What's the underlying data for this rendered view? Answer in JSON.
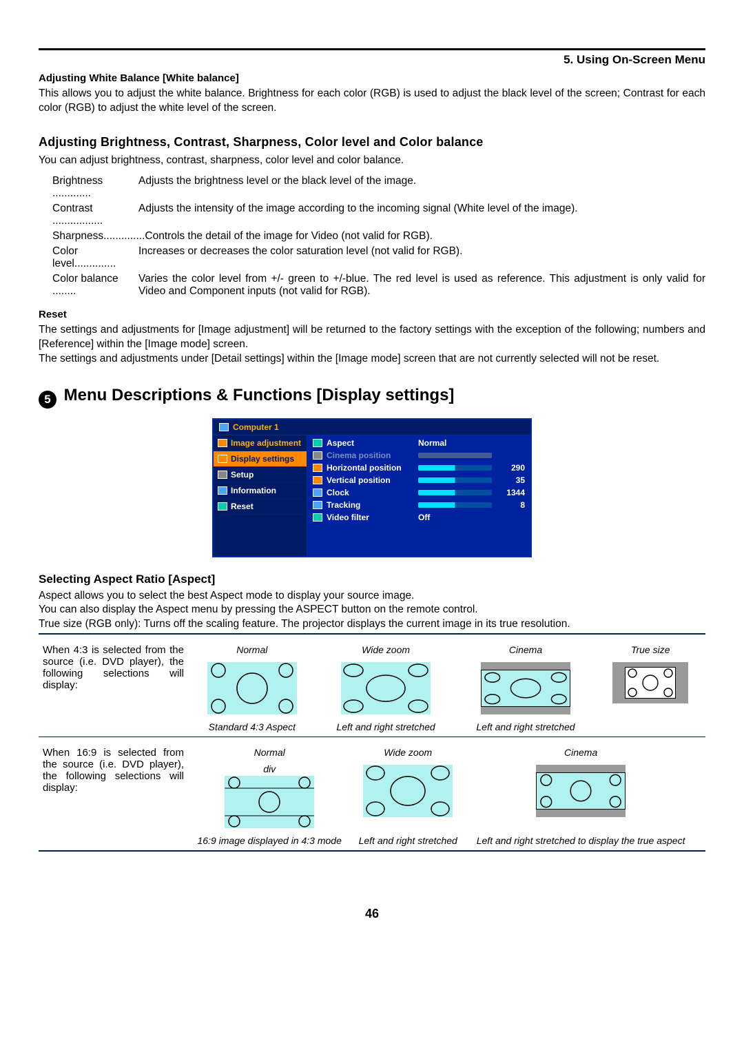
{
  "header": {
    "chapter": "5. Using On-Screen Menu"
  },
  "wb": {
    "title": "Adjusting White Balance [White balance]",
    "text": "This allows you to adjust the white balance. Brightness for each color (RGB) is used to adjust the black level of the screen; Contrast for each color (RGB) to adjust the white level of the screen."
  },
  "adj": {
    "title": "Adjusting Brightness, Contrast, Sharpness, Color level and Color balance",
    "intro": "You can adjust brightness, contrast, sharpness, color level and color balance.",
    "items": [
      {
        "term": "Brightness",
        "dots": " ............. ",
        "desc": "Adjusts the brightness level or the black level of the image."
      },
      {
        "term": "Contrast",
        "dots": " ................. ",
        "desc": "Adjusts the intensity of the image according to the incoming signal (White level of the image)."
      },
      {
        "term": "Sharpness",
        "dots": ".............. ",
        "desc": "Controls the detail of the image for Video (not valid for RGB)."
      },
      {
        "term": "Color level",
        "dots": ".............. ",
        "desc": "Increases or decreases the color saturation level (not valid for RGB)."
      },
      {
        "term": "Color balance",
        "dots": " ........ ",
        "desc": "Varies the color level from +/- green to +/-blue. The red level is used as reference. This adjustment is only valid for Video and Component inputs (not valid for RGB)."
      }
    ]
  },
  "reset": {
    "title": "Reset",
    "p1": "The settings and adjustments for [Image adjustment] will be returned to the factory settings with the exception of the following; numbers and [Reference] within the [Image mode] screen.",
    "p2": "The settings and adjustments under [Detail settings] within the [Image mode] screen that are not currently selected will not be reset."
  },
  "section5": {
    "bullet": "5",
    "title": "Menu Descriptions & Functions [Display settings]"
  },
  "osd": {
    "title": "Computer 1",
    "menu": [
      {
        "label": "Image adjustment"
      },
      {
        "label": "Display settings"
      },
      {
        "label": "Setup"
      },
      {
        "label": "Information"
      },
      {
        "label": "Reset"
      }
    ],
    "rows": [
      {
        "key": "Aspect",
        "value": "Normal",
        "num": "",
        "slider": false
      },
      {
        "key": "Cinema position",
        "value": "",
        "num": "",
        "slider": true,
        "dim": true
      },
      {
        "key": "Horizontal position",
        "value": "",
        "num": "290",
        "slider": true
      },
      {
        "key": "Vertical position",
        "value": "",
        "num": "35",
        "slider": true
      },
      {
        "key": "Clock",
        "value": "",
        "num": "1344",
        "slider": true
      },
      {
        "key": "Tracking",
        "value": "",
        "num": "8",
        "slider": true
      },
      {
        "key": "Video filter",
        "value": "Off",
        "num": "",
        "slider": false
      }
    ]
  },
  "aspect": {
    "title": "Selecting Aspect Ratio [Aspect]",
    "p1": "Aspect allows you to select the best Aspect mode to display your source image.",
    "p2": "You can also display the Aspect menu by pressing the ASPECT button on the remote control.",
    "p3": "True size (RGB only): Turns off the scaling feature. The projector displays the current image in its true resolution.",
    "row43_desc": "When 4:3 is selected from the source (i.e. DVD player), the following selections will display:",
    "row169_desc": "When 16:9 is selected from the source (i.e. DVD player), the following selections will display:",
    "headers43": [
      "Normal",
      "Wide zoom",
      "Cinema",
      "True size"
    ],
    "captions43": [
      "Standard 4:3 Aspect",
      "Left and right stretched",
      "Left and right stretched",
      ""
    ],
    "headers169": [
      "Normal",
      "Wide zoom",
      "Cinema",
      ""
    ],
    "captions169": [
      "16:9 image displayed in 4:3 mode",
      "Left and right stretched",
      "Left and right stretched to display the true aspect",
      ""
    ]
  },
  "page_number": "46"
}
